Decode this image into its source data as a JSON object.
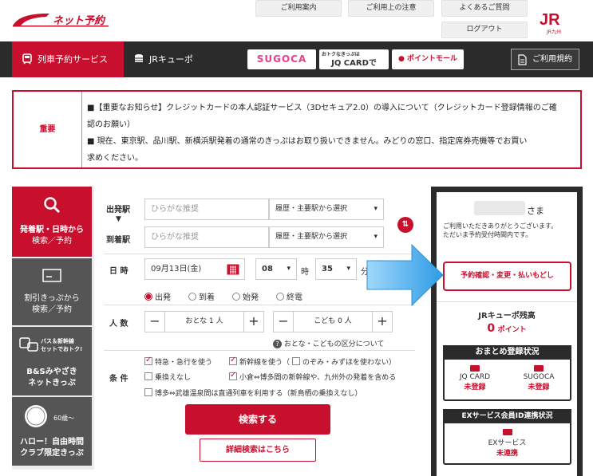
{
  "header": {
    "logo_text": "ネット予約",
    "top_links": [
      "ご利用案内",
      "ご利用上の注意",
      "よくあるご質問"
    ],
    "logout": "ログアウト",
    "jr_mark": "JR",
    "jr_sub": "JR九州"
  },
  "nav": {
    "items": [
      "列車予約サービス",
      "JRキューポ"
    ],
    "promos": [
      "SUGOCA",
      "おトクなきっぷは",
      "JQ CARDで",
      "ポイントモール"
    ],
    "terms": "ご利用規約"
  },
  "notice": {
    "label": "重要",
    "line1": "■【重要なお知らせ】クレジットカードの本人認証サービス（3Dセキュア2.0）の導入について（クレジットカード登録情報のご確",
    "line2": "認のお願い）",
    "line3": "■ 現在、東京駅、品川駅、新横浜駅発着の通常のきっぷはお取り扱いできません。みどりの窓口、指定席券売機等でお買い",
    "line4": "求めください。"
  },
  "side_tabs": [
    {
      "l1": "発着駅・日時から",
      "l2": "検索／予約"
    },
    {
      "l1": "割引きっぷから",
      "l2": "検索／予約"
    },
    {
      "badge1": "バス＆新幹線",
      "badge2": "セットでおトク!",
      "l1": "B&Sみやざき",
      "l2": "ネットきっぷ"
    },
    {
      "badge": "60歳〜",
      "l1": "ハロー！自由時間",
      "l2": "クラブ限定きっぷ"
    }
  ],
  "form": {
    "dep_label": "出発駅",
    "arr_label": "到着駅",
    "dep_placeholder": "ひらがな推奨",
    "arr_placeholder": "ひらがな推奨",
    "history_select": "履歴・主要駅から選択",
    "date_label": "日 時",
    "date_value": "09月13日(金)",
    "hour": "08",
    "hour_unit": "時",
    "minute": "35",
    "minute_unit": "分",
    "radios": [
      "出発",
      "到着",
      "始発",
      "終電"
    ],
    "people_label": "人 数",
    "adult": "おとな 1 人",
    "child": "こども 0 人",
    "age_note": "おとな・こどもの区分について",
    "cond_label": "条 件",
    "checks": [
      "特急・急行を使う",
      "新幹線を使う（",
      "のぞみ・みずほを使わない）",
      "乗換えなし",
      "小倉⇔博多間の新幹線や、九州外の発着を含める",
      "博多⇔武雄温泉間は直通列車を利用する（新鳥栖の乗換えなし）"
    ],
    "search": "検索する",
    "advanced": "詳細検索はこちら"
  },
  "account": {
    "sama": "さま",
    "greeting1": "ご利用いただきありがとうございます。",
    "greeting2": "ただいま予約受付時間内です。",
    "manage_button": "予約確認・変更・払いもどし",
    "points_title": "JRキューポ残高",
    "points_value": "0",
    "points_unit": "ポイント",
    "omatome_title": "おまとめ登録状況",
    "jqcard": "JQ CARD",
    "jqcard_status": "未登録",
    "sugoca": "SUGOCA",
    "sugoca_status": "未登録",
    "ex_title": "EXサービス会員ID連携状況",
    "ex_service": "EXサービス",
    "ex_status": "未連携"
  },
  "colors": {
    "brand": "#c8102e",
    "nav": "#2b2b2b",
    "arrow": "#3aa6e8"
  }
}
